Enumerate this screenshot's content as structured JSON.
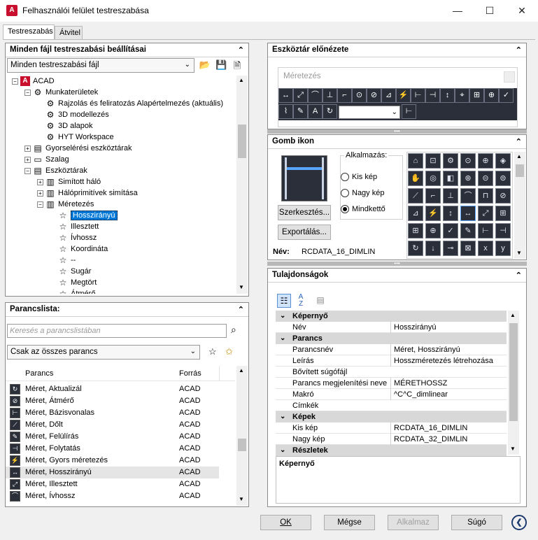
{
  "window": {
    "title": "Felhasználói felület testreszabása",
    "minimize": "—",
    "maximize": "☐",
    "close": "✕"
  },
  "tabs": [
    {
      "label": "Testreszabás",
      "active": true
    },
    {
      "label": "Átvitel",
      "active": false
    }
  ],
  "left_top": {
    "header": "Minden fájl testreszabási beállításai",
    "filter_select": "Minden testreszabási fájl",
    "tree": [
      {
        "label": "ACAD",
        "level": 0,
        "expander": "−",
        "icon": "acad-icon",
        "glyph": "A"
      },
      {
        "label": "Munkaterületek",
        "level": 1,
        "expander": "−",
        "icon": "gear-icon",
        "glyph": "⚙"
      },
      {
        "label": "Rajzolás és feliratozás Alapértelmezés (aktuális)",
        "level": 2,
        "expander": "",
        "icon": "gear-icon",
        "glyph": "⚙"
      },
      {
        "label": "3D modellezés",
        "level": 2,
        "expander": "",
        "icon": "gear-icon",
        "glyph": "⚙"
      },
      {
        "label": "3D alapok",
        "level": 2,
        "expander": "",
        "icon": "gear-icon",
        "glyph": "⚙"
      },
      {
        "label": "HYT Workspace",
        "level": 2,
        "expander": "",
        "icon": "gear-icon",
        "glyph": "⚙"
      },
      {
        "label": "Gyorselérési eszköztárak",
        "level": 1,
        "expander": "+",
        "icon": "toolbar-icon",
        "glyph": "▤"
      },
      {
        "label": "Szalag",
        "level": 1,
        "expander": "+",
        "icon": "ribbon-icon",
        "glyph": "▭"
      },
      {
        "label": "Eszköztárak",
        "level": 1,
        "expander": "−",
        "icon": "toolbar-icon",
        "glyph": "▤"
      },
      {
        "label": "Simított háló",
        "level": 2,
        "expander": "+",
        "icon": "toolbar-icon",
        "glyph": "▥"
      },
      {
        "label": "Hálóprimitívek simítása",
        "level": 2,
        "expander": "+",
        "icon": "toolbar-icon",
        "glyph": "▥"
      },
      {
        "label": "Méretezés",
        "level": 2,
        "expander": "−",
        "icon": "toolbar-icon",
        "glyph": "▥"
      },
      {
        "label": "Hosszirányú",
        "level": 3,
        "expander": "",
        "icon": "star-icon",
        "glyph": "☆",
        "selected": true
      },
      {
        "label": "Illesztett",
        "level": 3,
        "expander": "",
        "icon": "star-icon",
        "glyph": "☆"
      },
      {
        "label": "Ívhossz",
        "level": 3,
        "expander": "",
        "icon": "star-icon",
        "glyph": "☆"
      },
      {
        "label": "Koordináta",
        "level": 3,
        "expander": "",
        "icon": "star-icon",
        "glyph": "☆"
      },
      {
        "label": "--",
        "level": 3,
        "expander": "",
        "icon": "star-icon",
        "glyph": "☆"
      },
      {
        "label": "Sugár",
        "level": 3,
        "expander": "",
        "icon": "star-icon",
        "glyph": "☆"
      },
      {
        "label": "Megtört",
        "level": 3,
        "expander": "",
        "icon": "star-icon",
        "glyph": "☆"
      },
      {
        "label": "Átmérő",
        "level": 3,
        "expander": "",
        "icon": "star-icon",
        "glyph": "☆"
      }
    ]
  },
  "left_bottom": {
    "header": "Parancslista:",
    "search_placeholder": "Keresés a parancslistában",
    "filter_select": "Csak az összes parancs",
    "columns": {
      "command": "Parancs",
      "source": "Forrás"
    },
    "commands": [
      {
        "name": "Méret, Aktualizál",
        "source": "ACAD",
        "glyph": "↻"
      },
      {
        "name": "Méret, Átmérő",
        "source": "ACAD",
        "glyph": "⊘"
      },
      {
        "name": "Méret, Bázisvonalas",
        "source": "ACAD",
        "glyph": "⊢"
      },
      {
        "name": "Méret, Dőlt",
        "source": "ACAD",
        "glyph": "⟋"
      },
      {
        "name": "Méret, Felülírás",
        "source": "ACAD",
        "glyph": "✎"
      },
      {
        "name": "Méret, Folytatás",
        "source": "ACAD",
        "glyph": "⊣"
      },
      {
        "name": "Méret, Gyors méretezés",
        "source": "ACAD",
        "glyph": "⚡"
      },
      {
        "name": "Méret, Hosszirányú",
        "source": "ACAD",
        "glyph": "↔",
        "selected": true
      },
      {
        "name": "Méret, Illesztett",
        "source": "ACAD",
        "glyph": "⤢"
      },
      {
        "name": "Méret, Ívhossz",
        "source": "ACAD",
        "glyph": "⌒"
      }
    ]
  },
  "toolbar_preview": {
    "header": "Eszköztár előnézete",
    "toolbar_title": "Méretezés",
    "row1": [
      "↔",
      "⤢",
      "⌒",
      "⊥",
      "⌐",
      "⊙",
      "⊘",
      "⊿",
      "⚡",
      "⊢",
      "⊣",
      "↕",
      "⌖",
      "⊞",
      "⊕",
      "✓"
    ],
    "row2": [
      "⌇",
      "✎",
      "A",
      "↻"
    ]
  },
  "button_image": {
    "header": "Gomb ikon",
    "apply_label": "Alkalmazás:",
    "radios": [
      {
        "label": "Kis kép",
        "checked": false
      },
      {
        "label": "Nagy kép",
        "checked": false
      },
      {
        "label": "Mindkettő",
        "checked": true
      }
    ],
    "edit_button": "Szerkesztés...",
    "export_button": "Exportálás...",
    "name_label": "Név:",
    "name_value": "RCDATA_16_DIMLIN",
    "icons": [
      "⌂",
      "⊡",
      "⚙",
      "⊙",
      "⊕",
      "◈",
      "✋",
      "◎",
      "◧",
      "⊛",
      "⊝",
      "⊜",
      "⟋",
      "⌐",
      "⊥",
      "⌒",
      "⊓",
      "⊘",
      "⊿",
      "⚡",
      "↕",
      "↔",
      "⤢",
      "⊞",
      "⊞",
      "⊕",
      "✓",
      "✎",
      "⊢",
      "⊣",
      "↻",
      "↓",
      "⊸",
      "⊠",
      "x",
      "y"
    ]
  },
  "properties": {
    "header": "Tulajdonságok",
    "categories": [
      {
        "label": "Képernyő",
        "rows": [
          {
            "key": "Név",
            "value": "Hosszirányú"
          }
        ]
      },
      {
        "label": "Parancs",
        "rows": [
          {
            "key": "Parancsnév",
            "value": "Méret, Hosszirányú"
          },
          {
            "key": "Leírás",
            "value": "Hosszméretezés létrehozása"
          },
          {
            "key": "Bővített súgófájl",
            "value": ""
          },
          {
            "key": "Parancs megjelenítési neve",
            "value": "MÉRETHOSSZ"
          },
          {
            "key": "Makró",
            "value": "^C^C_dimlinear"
          },
          {
            "key": "Címkék",
            "value": ""
          }
        ]
      },
      {
        "label": "Képek",
        "rows": [
          {
            "key": "Kis kép",
            "value": "RCDATA_16_DIMLIN"
          },
          {
            "key": "Nagy kép",
            "value": "RCDATA_32_DIMLIN"
          }
        ]
      },
      {
        "label": "Részletek",
        "rows": []
      }
    ],
    "description_title": "Képernyő"
  },
  "footer": {
    "ok": "OK",
    "cancel": "Mégse",
    "apply": "Alkalmaz",
    "help": "Súgó",
    "collapse_glyph": "❮"
  }
}
